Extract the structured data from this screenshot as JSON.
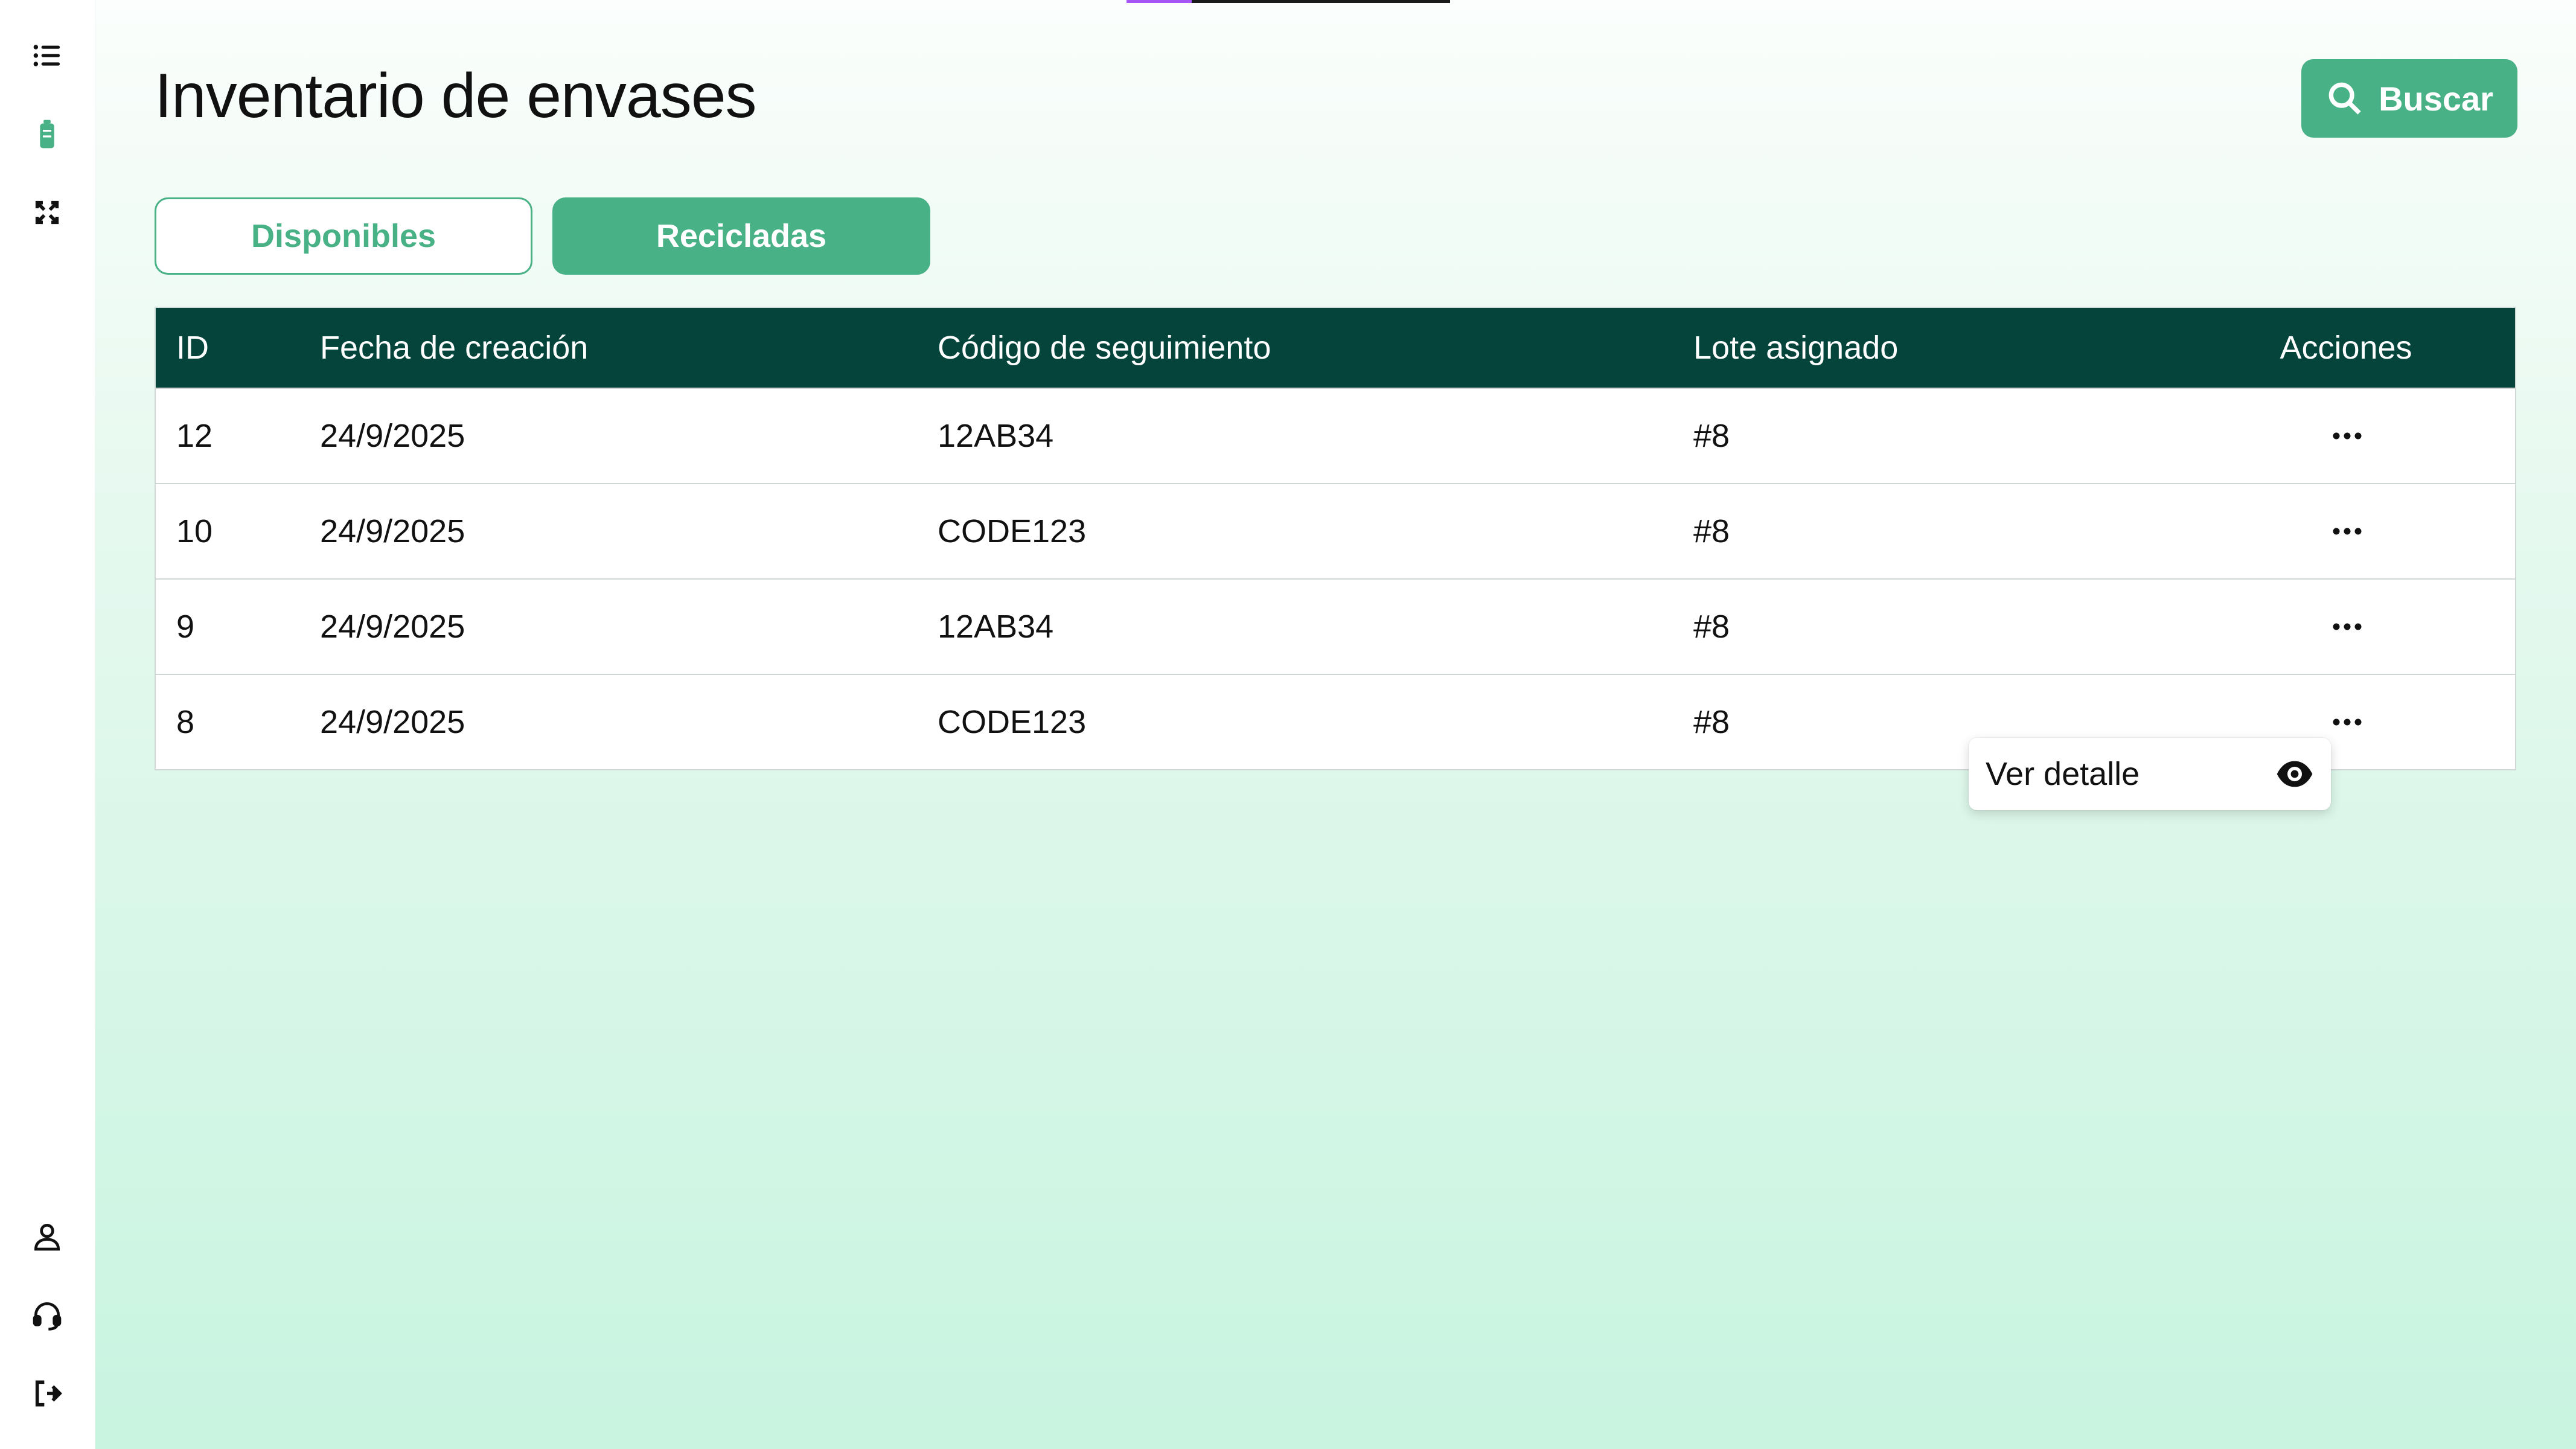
{
  "sidebar": {
    "top_icons": [
      "list-icon",
      "battery-icon",
      "recycle-icon"
    ],
    "bottom_icons": [
      "user-icon",
      "headset-icon",
      "logout-icon"
    ],
    "active_color": "#48b185"
  },
  "header": {
    "title": "Inventario de envases",
    "search_label": "Buscar"
  },
  "tabs": [
    {
      "label": "Disponibles",
      "active": false
    },
    {
      "label": "Recicladas",
      "active": true
    }
  ],
  "table": {
    "columns": [
      "ID",
      "Fecha de creación",
      "Código de seguimiento",
      "Lote asignado",
      "Acciones"
    ],
    "rows": [
      {
        "id": "12",
        "date": "24/9/2025",
        "code": "12AB34",
        "batch": "#8"
      },
      {
        "id": "10",
        "date": "24/9/2025",
        "code": "CODE123",
        "batch": "#8"
      },
      {
        "id": "9",
        "date": "24/9/2025",
        "code": "12AB34",
        "batch": "#8"
      },
      {
        "id": "8",
        "date": "24/9/2025",
        "code": "CODE123",
        "batch": "#8"
      }
    ]
  },
  "dropdown": {
    "item_label": "Ver detalle",
    "item_icon": "eye-icon"
  },
  "colors": {
    "accent": "#48b185",
    "table_header": "#04443b"
  }
}
